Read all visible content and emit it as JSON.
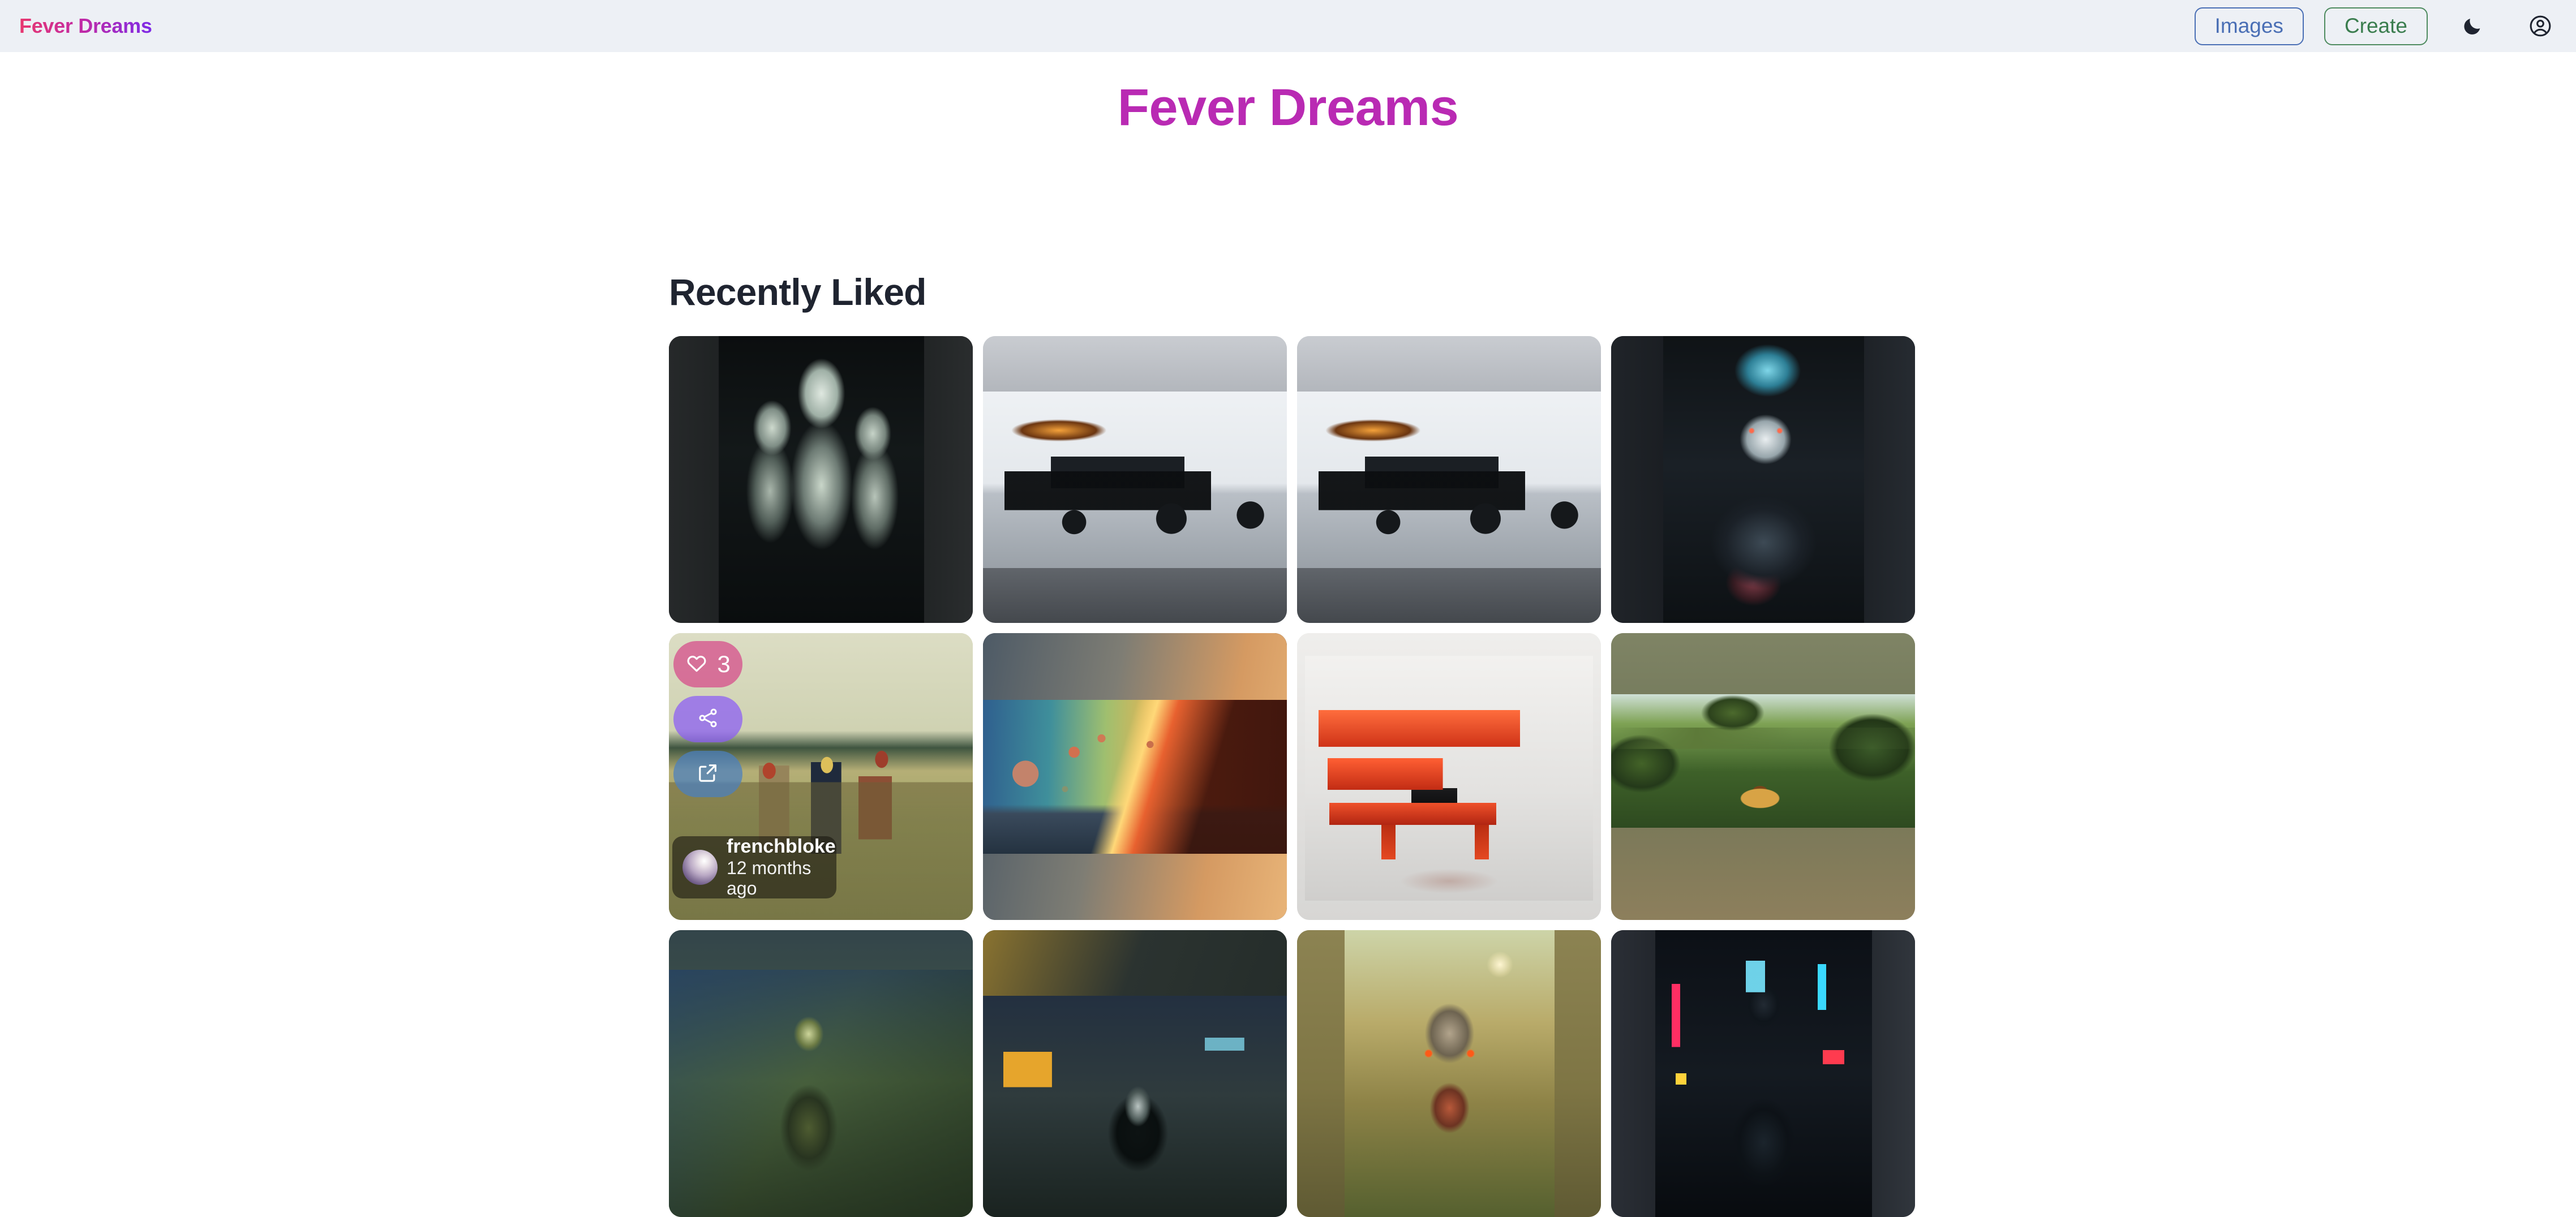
{
  "navbar": {
    "brand": "Fever Dreams",
    "images_label": "Images",
    "create_label": "Create",
    "theme_toggle_icon": "moon-icon",
    "account_icon": "account-circle-icon",
    "background_color": "#edf0f5",
    "images_color": "#4a6fb5",
    "create_color": "#3a7d4e"
  },
  "hero": {
    "title": "Fever Dreams",
    "color": "#b92ab3"
  },
  "section": {
    "title": "Recently Liked",
    "title_color": "#1f2430"
  },
  "gallery": {
    "tiles": [
      {
        "art": "art-ghouls",
        "alt": "three pale gaunt figures in darkness",
        "letterboxed": false
      },
      {
        "art": "art-car",
        "alt": "black custom hot rod racer in a showroom",
        "letterboxed": true
      },
      {
        "art": "art-car",
        "alt": "black custom hot rod racer, side view",
        "letterboxed": true
      },
      {
        "art": "art-lich",
        "alt": "dark fantasy lich with glowing red eyes and blue flame hair",
        "letterboxed": false
      },
      {
        "art": "art-field",
        "alt": "three men in knitted masks standing in a field",
        "letterboxed": false
      },
      {
        "art": "art-space",
        "alt": "alien planetscape with planets and rainbow horizon",
        "letterboxed": true
      },
      {
        "art": "art-turntable",
        "alt": "red retro-futuristic turntable machine",
        "letterboxed": false
      },
      {
        "art": "art-jungle",
        "alt": "greenhouse jungle dining table",
        "letterboxed": true
      },
      {
        "art": "art-swamp",
        "alt": "green swamp creature painting",
        "letterboxed": true
      },
      {
        "art": "art-corridor",
        "alt": "dark figure in a lit corridor",
        "letterboxed": true
      },
      {
        "art": "art-cthulhu",
        "alt": "cthulhu-like being in a sunlit grass field",
        "letterboxed": false
      },
      {
        "art": "art-cyber",
        "alt": "cyberpunk figure with visor helmet in neon rain",
        "letterboxed": false
      }
    ]
  },
  "hover_card": {
    "tile_index": 4,
    "like_icon": "heart-icon",
    "like_count": "3",
    "share_icon": "share-icon",
    "open_icon": "external-link-icon",
    "username": "frenchbloke",
    "timestamp": "12 months ago",
    "like_color": "#d6568f",
    "share_color": "#8b5cf6",
    "open_color": "#4a7fc0"
  }
}
